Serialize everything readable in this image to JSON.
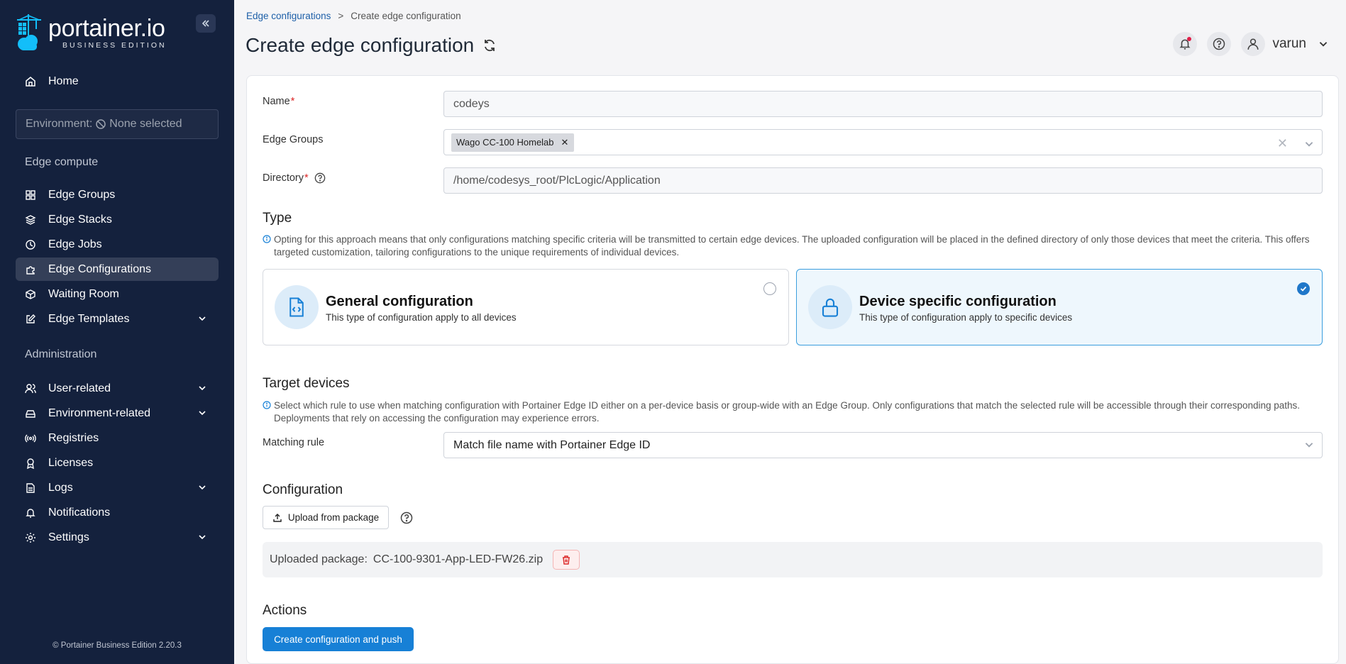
{
  "brand": {
    "name": "portainer.io",
    "edition": "BUSINESS EDITION"
  },
  "sidebar": {
    "home": "Home",
    "environment": {
      "prefix": "Environment:",
      "value": "None selected"
    },
    "sections": {
      "edge_compute": "Edge compute",
      "administration": "Administration"
    },
    "items": [
      {
        "label": "Edge Groups",
        "icon": "grid-icon"
      },
      {
        "label": "Edge Stacks",
        "icon": "layers-icon"
      },
      {
        "label": "Edge Jobs",
        "icon": "clock-icon"
      },
      {
        "label": "Edge Configurations",
        "icon": "puzzle-icon",
        "active": true
      },
      {
        "label": "Waiting Room",
        "icon": "box-icon"
      },
      {
        "label": "Edge Templates",
        "icon": "edit-icon",
        "expandable": true
      },
      {
        "label": "User-related",
        "icon": "users-icon",
        "expandable": true
      },
      {
        "label": "Environment-related",
        "icon": "hdd-icon",
        "expandable": true
      },
      {
        "label": "Registries",
        "icon": "radio-icon"
      },
      {
        "label": "Licenses",
        "icon": "license-icon"
      },
      {
        "label": "Logs",
        "icon": "file-icon",
        "expandable": true
      },
      {
        "label": "Notifications",
        "icon": "bell-icon"
      },
      {
        "label": "Settings",
        "icon": "gear-icon",
        "expandable": true
      }
    ],
    "footer": "© Portainer Business Edition 2.20.3"
  },
  "breadcrumb": {
    "parent": "Edge configurations",
    "current": "Create edge configuration"
  },
  "page_title": "Create edge configuration",
  "user": {
    "name": "varun"
  },
  "form": {
    "name_label": "Name",
    "name_value": "codeys",
    "groups_label": "Edge Groups",
    "groups_tag": "Wago CC-100 Homelab",
    "directory_label": "Directory",
    "directory_value": "/home/codesys_root/PlcLogic/Application",
    "required_mark": "*"
  },
  "type": {
    "title": "Type",
    "info": "Opting for this approach means that only configurations matching specific criteria will be transmitted to certain edge devices. The uploaded configuration will be placed in the defined directory of only those devices that meet the criteria. This offers targeted customization, tailoring configurations to the unique requirements of individual devices.",
    "general": {
      "title": "General configuration",
      "desc": "This type of configuration apply to all devices",
      "selected": false
    },
    "specific": {
      "title": "Device specific configuration",
      "desc": "This type of configuration apply to specific devices",
      "selected": true
    }
  },
  "target": {
    "title": "Target devices",
    "info": "Select which rule to use when matching configuration with Portainer Edge ID either on a per-device basis or group-wide with an Edge Group. Only configurations that match the selected rule will be accessible through their corresponding paths. Deployments that rely on accessing the configuration may experience errors.",
    "rule_label": "Matching rule",
    "rule_value": "Match file name with Portainer Edge ID"
  },
  "configuration": {
    "title": "Configuration",
    "upload_label": "Upload from package",
    "package_prefix": "Uploaded package:",
    "package_file": "CC-100-9301-App-LED-FW26.zip"
  },
  "actions": {
    "title": "Actions",
    "submit": "Create configuration and push"
  },
  "colors": {
    "sidebar_bg": "#14213d",
    "primary": "#1780d6",
    "danger": "#dc2626"
  }
}
